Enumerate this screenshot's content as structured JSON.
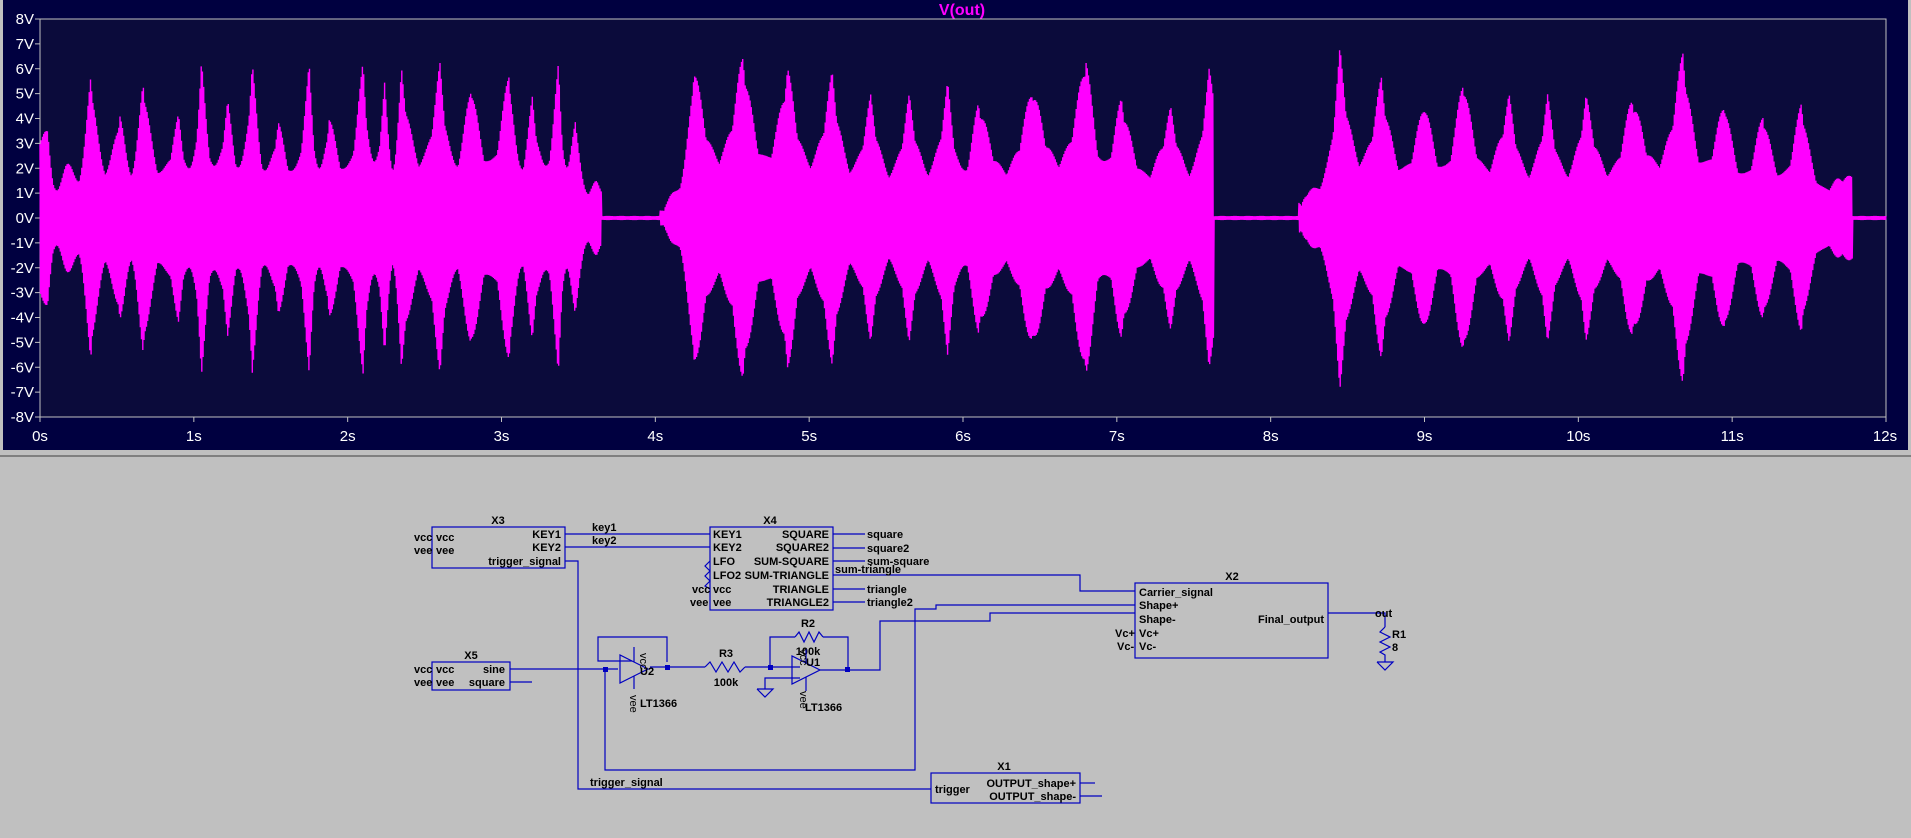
{
  "waveform_viewer": {
    "trace_name": "V(out)",
    "colors": {
      "background": "#0b0b3b",
      "trace": "#ff00ff",
      "grid": "#c0c0c0",
      "text": "#ffffff"
    }
  },
  "chart_data": {
    "type": "line",
    "title": "V(out)",
    "xlabel": "",
    "ylabel": "",
    "x_ticks": [
      "0s",
      "1s",
      "2s",
      "3s",
      "4s",
      "5s",
      "6s",
      "7s",
      "8s",
      "9s",
      "10s",
      "11s",
      "12s"
    ],
    "y_ticks": [
      "8V",
      "7V",
      "6V",
      "5V",
      "4V",
      "3V",
      "2V",
      "1V",
      "0V",
      "-1V",
      "-2V",
      "-3V",
      "-4V",
      "-5V",
      "-6V",
      "-7V",
      "-8V"
    ],
    "xlim": [
      0,
      12
    ],
    "ylim": [
      -8,
      8
    ],
    "grid": false,
    "series": [
      {
        "name": "V(out)",
        "envelope_peaks": [
          {
            "t": 0.05,
            "v": 3.5
          },
          {
            "t": 0.17,
            "v": 2.5
          },
          {
            "t": 0.33,
            "v": 6.3
          },
          {
            "t": 0.52,
            "v": 4.5
          },
          {
            "t": 0.67,
            "v": 6.0
          },
          {
            "t": 0.9,
            "v": 4.2
          },
          {
            "t": 1.05,
            "v": 6.4
          },
          {
            "t": 1.22,
            "v": 4.8
          },
          {
            "t": 1.38,
            "v": 6.5
          },
          {
            "t": 1.55,
            "v": 4.0
          },
          {
            "t": 1.75,
            "v": 6.3
          },
          {
            "t": 1.88,
            "v": 4.3
          },
          {
            "t": 2.1,
            "v": 6.5
          },
          {
            "t": 2.24,
            "v": 5.5
          },
          {
            "t": 2.35,
            "v": 6.2
          },
          {
            "t": 2.6,
            "v": 6.3
          },
          {
            "t": 2.8,
            "v": 5.8
          },
          {
            "t": 3.05,
            "v": 6.4
          },
          {
            "t": 3.2,
            "v": 5.0
          },
          {
            "t": 3.37,
            "v": 6.4
          },
          {
            "t": 3.48,
            "v": 4.5
          },
          {
            "t": 3.62,
            "v": 1.5
          },
          {
            "t": 4.05,
            "v": 0.1
          },
          {
            "t": 4.25,
            "v": 6.5
          },
          {
            "t": 4.57,
            "v": 6.9
          },
          {
            "t": 4.86,
            "v": 6.3
          },
          {
            "t": 5.15,
            "v": 6.0
          },
          {
            "t": 5.4,
            "v": 5.0
          },
          {
            "t": 5.65,
            "v": 5.0
          },
          {
            "t": 5.9,
            "v": 5.5
          },
          {
            "t": 6.1,
            "v": 5.0
          },
          {
            "t": 6.45,
            "v": 5.6
          },
          {
            "t": 6.8,
            "v": 7.0
          },
          {
            "t": 7.03,
            "v": 5.1
          },
          {
            "t": 7.35,
            "v": 4.5
          },
          {
            "t": 7.6,
            "v": 6.0
          },
          {
            "t": 8.2,
            "v": 0.5
          },
          {
            "t": 8.45,
            "v": 6.9
          },
          {
            "t": 8.72,
            "v": 5.8
          },
          {
            "t": 9.0,
            "v": 5.0
          },
          {
            "t": 9.25,
            "v": 6.0
          },
          {
            "t": 9.55,
            "v": 5.0
          },
          {
            "t": 9.8,
            "v": 5.0
          },
          {
            "t": 10.05,
            "v": 5.0
          },
          {
            "t": 10.35,
            "v": 5.2
          },
          {
            "t": 10.68,
            "v": 7.0
          },
          {
            "t": 10.95,
            "v": 5.0
          },
          {
            "t": 11.2,
            "v": 4.5
          },
          {
            "t": 11.45,
            "v": 5.0
          },
          {
            "t": 11.72,
            "v": 1.7
          }
        ],
        "silent_intervals": [
          [
            3.65,
            4.03
          ],
          [
            7.63,
            8.18
          ],
          [
            11.78,
            12.0
          ]
        ]
      }
    ]
  },
  "schematic": {
    "wire_color": "#0000c0",
    "symbol_color": "#0000c0",
    "x3": {
      "ref": "X3",
      "pins_left": [
        "vcc",
        "vee"
      ],
      "pins_right": [
        "KEY1",
        "KEY2",
        "trigger_signal"
      ],
      "ext_left": [
        "vcc",
        "vee"
      ]
    },
    "x4": {
      "ref": "X4",
      "pins_left": [
        "KEY1",
        "KEY2",
        "LFO",
        "LFO2",
        "vcc",
        "vee"
      ],
      "pins_right": [
        "SQUARE",
        "SQUARE2",
        "SUM-SQUARE",
        "SUM-TRIANGLE",
        "TRIANGLE",
        "TRIANGLE2"
      ],
      "ext_left": [
        "vcc",
        "vee"
      ]
    },
    "x2": {
      "ref": "X2",
      "pins_left": [
        "Carrier_signal",
        "Shape+",
        "Shape-",
        "Vc+",
        "Vc-"
      ],
      "pins_right": [
        "Final_output"
      ],
      "ext_left": [
        "Vc+",
        "Vc-"
      ]
    },
    "x5": {
      "ref": "X5",
      "pins_left": [
        "vcc",
        "vee"
      ],
      "pins_right": [
        "sine",
        "square"
      ],
      "ext_left": [
        "vcc",
        "vee"
      ]
    },
    "x1": {
      "ref": "X1",
      "pins_left": [
        "trigger"
      ],
      "pins_right": [
        "OUTPUT_shape+",
        "OUTPUT_shape-"
      ]
    },
    "net_labels": {
      "key1": "key1",
      "key2": "key2",
      "square": "square",
      "square2": "square2",
      "sum_square": "sum-square",
      "sum_triangle": "sum-triangle",
      "triangle": "triangle",
      "triangle2": "triangle2",
      "trigger_signal": "trigger_signal",
      "out": "out"
    },
    "u2": {
      "ref": "U2",
      "model": "LT1366",
      "pin_top": "vcc",
      "pin_bottom": "vee"
    },
    "u1": {
      "ref": "U1",
      "model": "LT1366",
      "pin_top": "vcc",
      "pin_bottom": "vee"
    },
    "r3": {
      "ref": "R3",
      "value": "100k"
    },
    "r2": {
      "ref": "R2",
      "value": "100k"
    },
    "r1": {
      "ref": "R1",
      "value": "8"
    }
  }
}
